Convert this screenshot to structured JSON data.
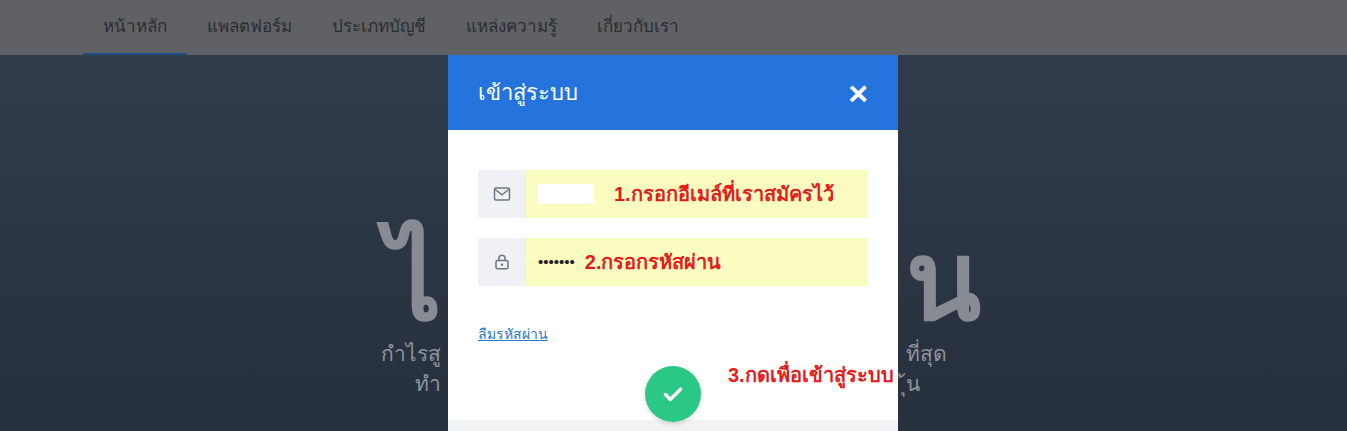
{
  "nav": {
    "items": [
      {
        "label": "หน้าหลัก",
        "selected": true
      },
      {
        "label": "แพลตฟอร์ม",
        "selected": false
      },
      {
        "label": "ประเภทบัญชี",
        "selected": false
      },
      {
        "label": "แหล่งความรู้",
        "selected": false
      },
      {
        "label": "เกี่ยวกับเรา",
        "selected": false
      }
    ]
  },
  "hero": {
    "title_left": "ไ",
    "title_right": "น",
    "lines": [
      {
        "left": "กำไรสู",
        "right": "ที่สุด"
      },
      {
        "left": "ทำ",
        "right": "ุ้น"
      }
    ]
  },
  "modal": {
    "title": "เข้าสู่ระบบ",
    "close": "×",
    "fields": [
      {
        "kind": "email",
        "masked": true,
        "value": "",
        "annotation": "1.กรอกอีเมล์ที่เราสมัครไว้"
      },
      {
        "kind": "password",
        "masked": false,
        "value": "•••••••",
        "annotation": "2.กรอกรหัสผ่าน"
      }
    ],
    "forgot": "ลืมรหัสผ่าน",
    "submit": {
      "annotation": "3.กดเพื่อเข้าสู่ระบบ"
    }
  }
}
